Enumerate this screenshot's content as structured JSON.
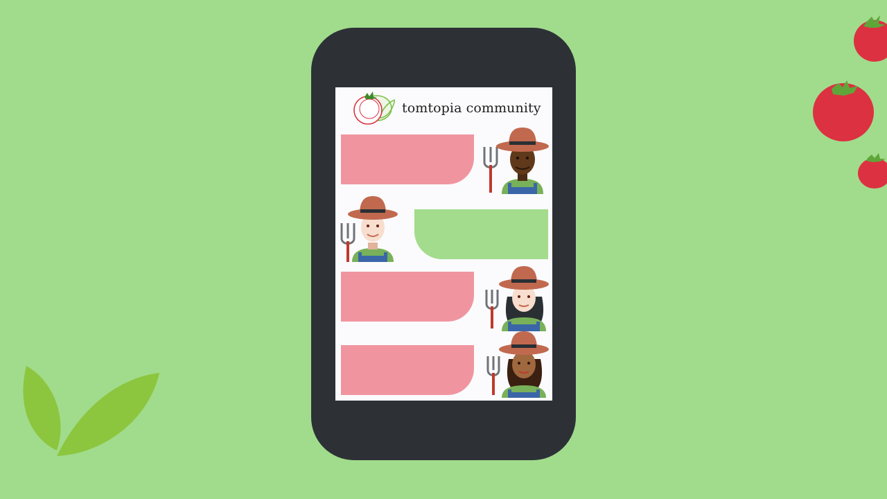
{
  "app": {
    "title": "tomtopia community"
  },
  "colors": {
    "background": "#a1dc8c",
    "phone_body": "#2d3136",
    "screen": "#fbfbfd",
    "bubble_pink": "#f0959f",
    "bubble_green": "#a2dc8c",
    "tomato_red": "#dc3141",
    "leaf_green": "#8cc63f"
  },
  "feed": {
    "messages": [
      {
        "side": "left",
        "bubble": "bubble_pink",
        "avatar_icon": "farmer-dark-skin-icon"
      },
      {
        "side": "right",
        "bubble": "bubble_green",
        "avatar_icon": "farmer-light-skin-icon"
      },
      {
        "side": "left",
        "bubble": "bubble_pink",
        "avatar_icon": "farmer-woman-light-skin-icon"
      },
      {
        "side": "left",
        "bubble": "bubble_pink",
        "avatar_icon": "farmer-woman-medium-dark-skin-icon"
      }
    ]
  },
  "decor": {
    "logo_icon": "tomato-leaf-logo-icon",
    "leaves_icon": "green-leaves-icon",
    "tomatoes_icon": "tomato-icon"
  }
}
